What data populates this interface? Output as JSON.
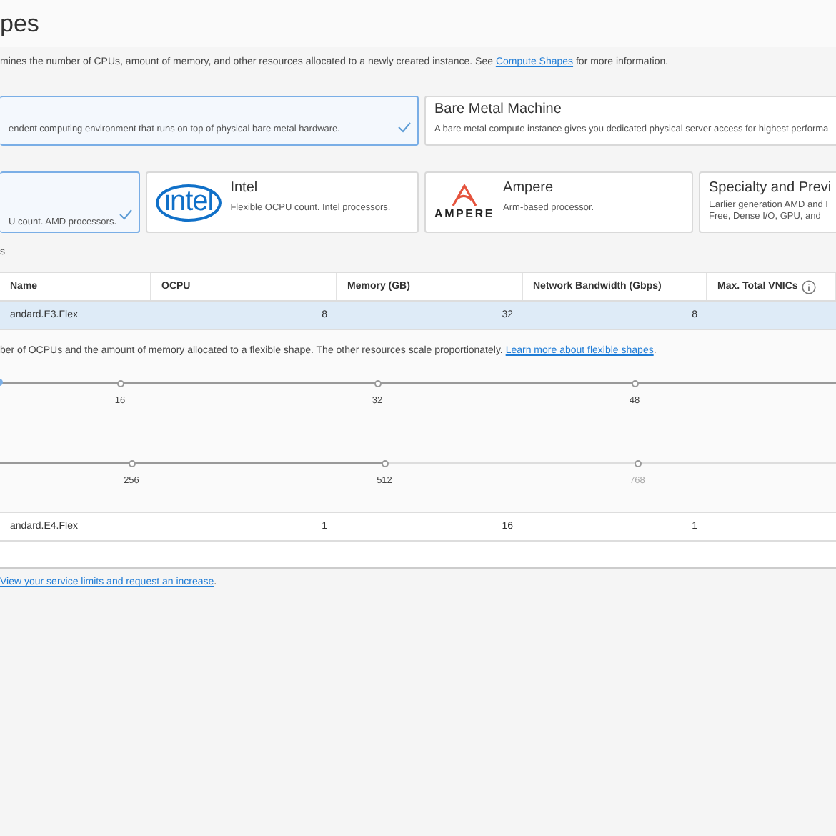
{
  "page_title": "pes",
  "description": {
    "text": "mines the number of CPUs, amount of memory, and other resources allocated to a newly created instance. See ",
    "link": "Compute Shapes",
    "after": " for more information."
  },
  "shape_types": [
    {
      "description": "endent computing environment that runs on top of physical bare metal hardware.",
      "selected": true
    },
    {
      "title": "Bare Metal Machine",
      "description": "A bare metal compute instance gives you dedicated physical server access for highest performa",
      "selected": false
    }
  ],
  "shape_series": [
    {
      "kind": "plain",
      "lines": [
        "U count. AMD processors."
      ],
      "selected": true
    },
    {
      "kind": "intel",
      "logo": "intel",
      "title": "Intel",
      "lines": [
        "Flexible OCPU count. Intel processors."
      ],
      "selected": false
    },
    {
      "kind": "ampere",
      "logo": "AMPERE",
      "title": "Ampere",
      "lines": [
        "Arm-based processor."
      ],
      "selected": false
    },
    {
      "kind": "plain",
      "title": "Specialty and Previ",
      "lines": [
        "Earlier generation AMD and I",
        "Free, Dense I/O, GPU, and"
      ],
      "selected": false
    }
  ],
  "section_label": "s",
  "table": {
    "columns": [
      "Name",
      "OCPU",
      "Memory (GB)",
      "Network Bandwidth (Gbps)",
      "Max. Total VNICs"
    ],
    "rows": [
      {
        "cells": [
          "andard.E3.Flex",
          "8",
          "32",
          "8"
        ],
        "selected": true,
        "detail": {
          "text": "ber of OCPUs and the amount of memory allocated to a flexible shape. The other resources scale proportionately. ",
          "link": "Learn more about flexible shapes",
          "after": ".",
          "sliders": [
            {
              "level": 1,
              "ticks": [
                {
                  "label": "16",
                  "disabled": false
                },
                {
                  "label": "32",
                  "disabled": false
                },
                {
                  "label": "48",
                  "disabled": false
                }
              ]
            },
            {
              "level": 0.46,
              "ticks": [
                {
                  "label": "256",
                  "disabled": false
                },
                {
                  "label": "512",
                  "disabled": false
                },
                {
                  "label": "768",
                  "disabled": true
                }
              ]
            }
          ]
        }
      },
      {
        "cells": [
          "andard.E4.Flex",
          "1",
          "16",
          "1"
        ],
        "selected": false
      }
    ]
  },
  "footer": {
    "link": "View your service limits and request an increase",
    "after": "."
  }
}
